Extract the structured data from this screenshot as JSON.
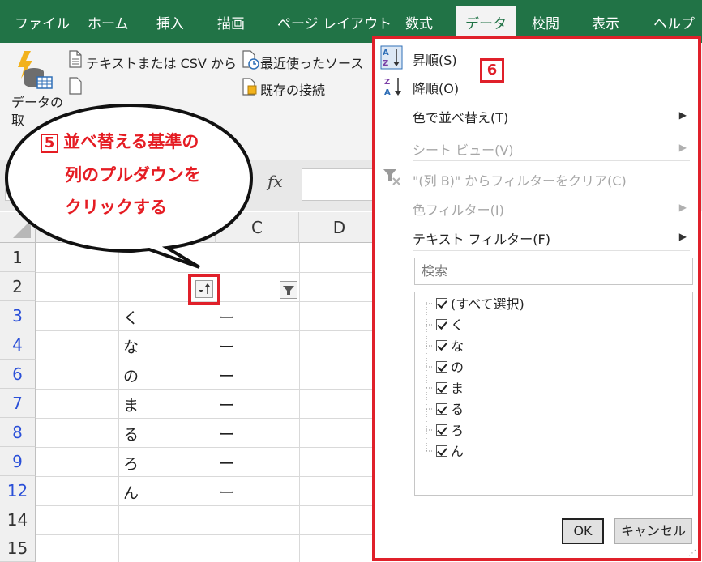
{
  "ribbon_tabs": [
    "ファイル",
    "ホーム",
    "挿入",
    "描画",
    "ページ レイアウト",
    "数式",
    "データ",
    "校閲",
    "表示",
    "ヘルプ"
  ],
  "active_tab": "データ",
  "ribbon": {
    "get_data": "データの",
    "get_data_2": "取",
    "from_text_csv": "テキストまたは CSV から",
    "recent_sources": "最近使ったソース",
    "existing_connections": "既存の接続"
  },
  "formula_bar": {
    "fx": "fx"
  },
  "columns": [
    "C",
    "D"
  ],
  "rows": [
    "1",
    "2",
    "3",
    "4",
    "6",
    "7",
    "8",
    "9",
    "12",
    "14",
    "15"
  ],
  "column_b_values": [
    "く",
    "な",
    "の",
    "ま",
    "る",
    "ろ",
    "ん"
  ],
  "column_c_values": [
    "ー",
    "ー",
    "ー",
    "ー",
    "ー",
    "ー",
    "ー"
  ],
  "callout": {
    "step_number": "5",
    "line1": "並べ替える基準の",
    "line2": "列のプルダウンを",
    "line3": "クリックする"
  },
  "menu": {
    "step_number": "6",
    "sort_asc": "昇順(S)",
    "sort_desc": "降順(O)",
    "sort_by_color": "色で並べ替え(T)",
    "sheet_view": "シート ビュー(V)",
    "clear_filter": "\"(列 B)\" からフィルターをクリア(C)",
    "color_filter": "色フィルター(I)",
    "text_filter": "テキスト フィルター(F)",
    "search_placeholder": "検索",
    "list_items": [
      "(すべて選択)",
      "く",
      "な",
      "の",
      "ま",
      "る",
      "ろ",
      "ん"
    ],
    "ok": "OK",
    "cancel": "キャンセル"
  },
  "colors": {
    "excel_green": "#217346",
    "highlight_red": "#e0202a",
    "filtered_row_blue": "#2a4fd8"
  }
}
